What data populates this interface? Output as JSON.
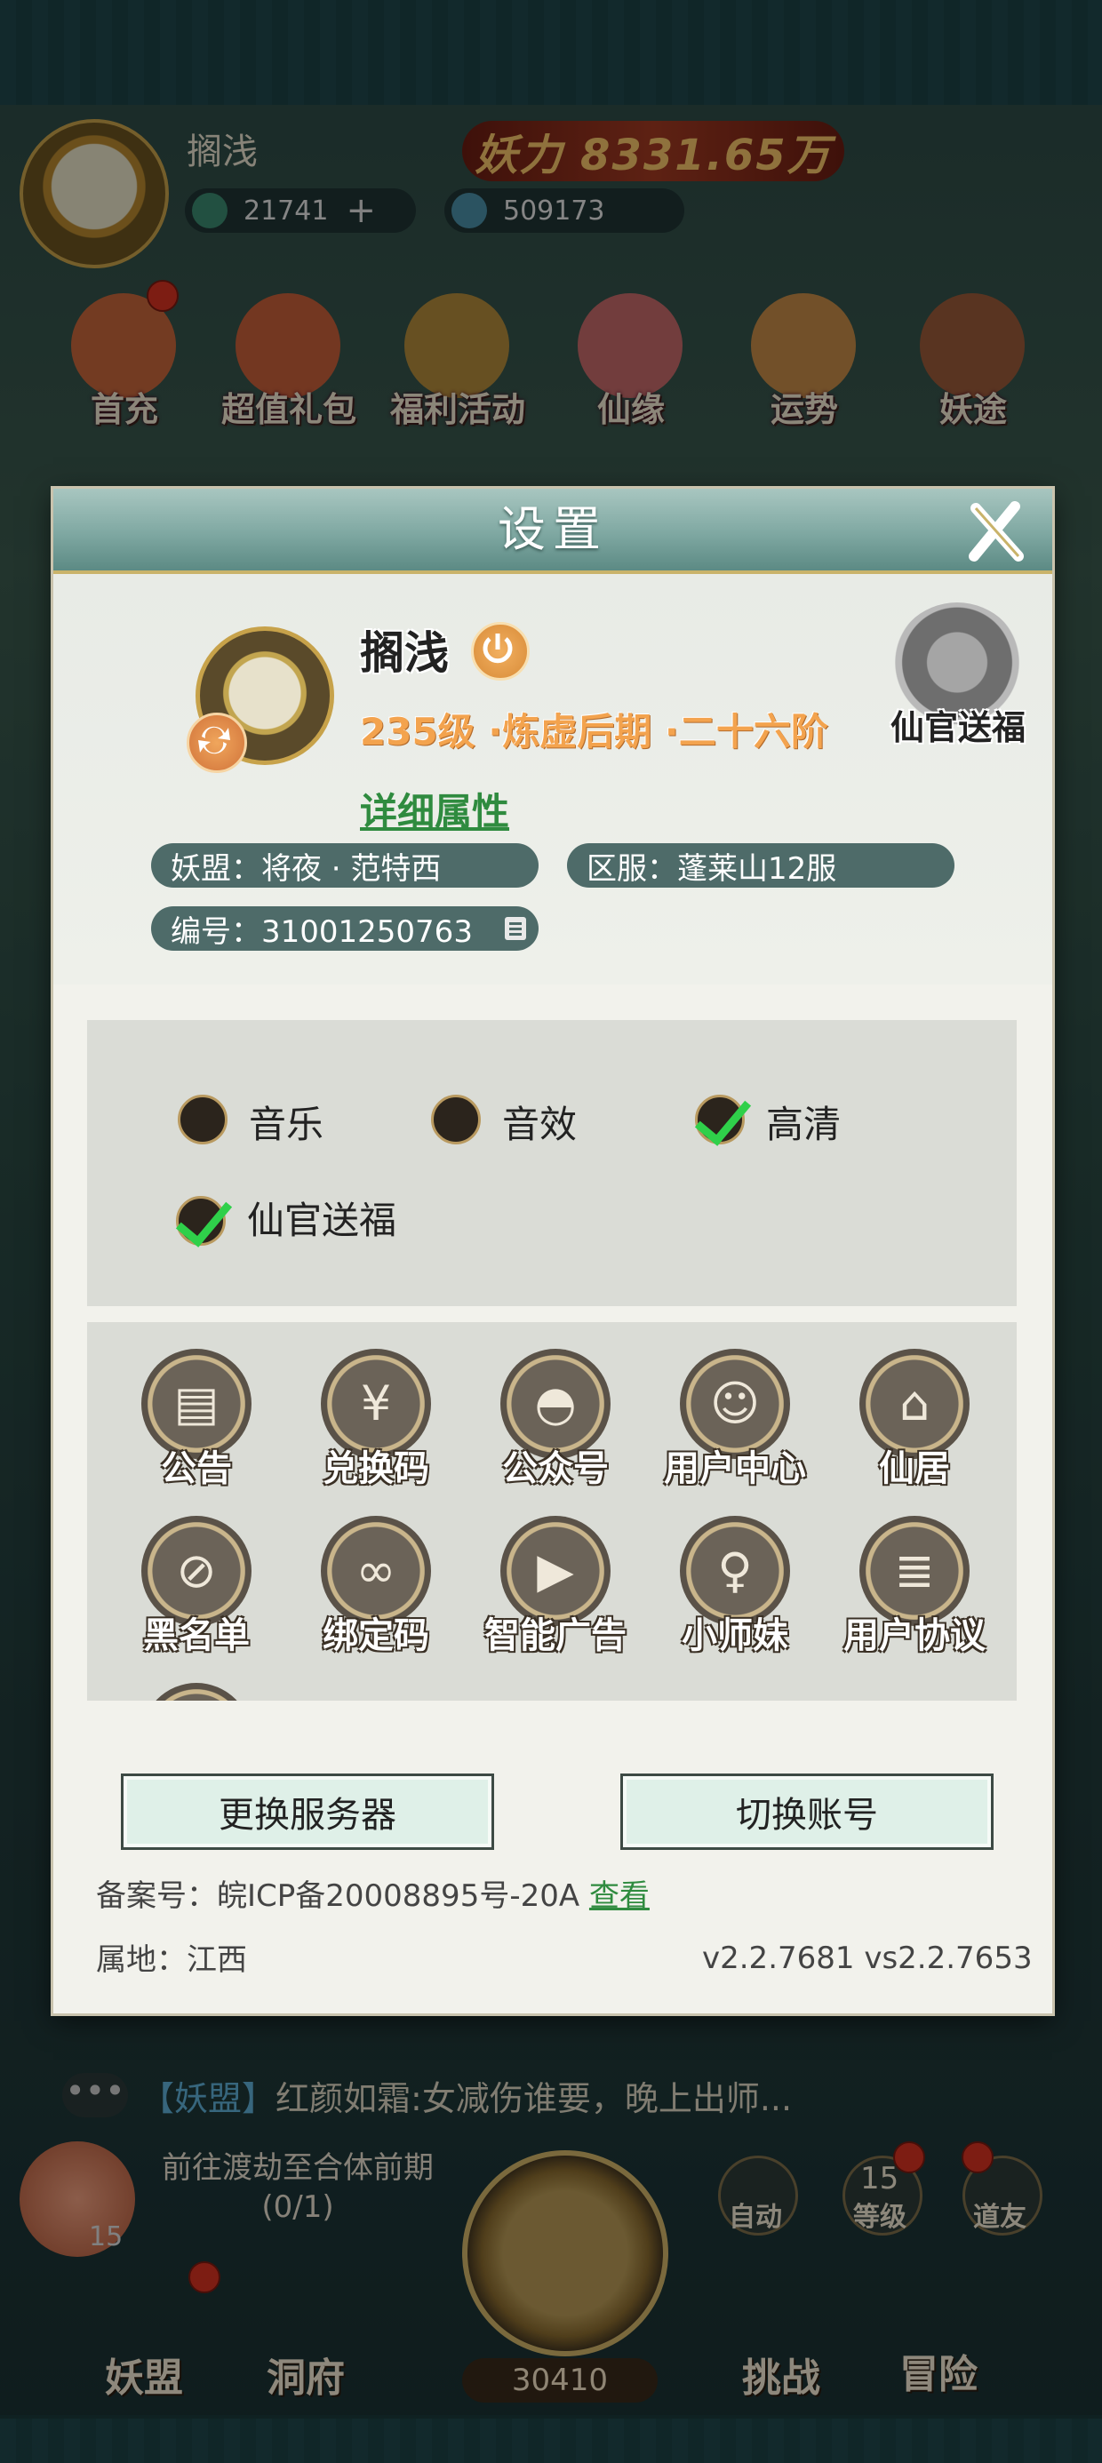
{
  "hud": {
    "player_name": "搁浅",
    "power_text": "妖力 8331.65万",
    "currency1": "21741",
    "currency2": "509173",
    "features": [
      "首充",
      "超值礼包",
      "福利活动",
      "仙缘",
      "运势",
      "妖途"
    ]
  },
  "chat": {
    "channel": "【妖盟】",
    "message": "红颜如霜:女减伤谁要，晚上出师..."
  },
  "quest": {
    "text": "前往渡劫至合体前期(0/1)"
  },
  "bottom": {
    "level_badge": "15",
    "counter": "30410",
    "side_buttons": [
      "自动",
      "等级",
      "道友"
    ],
    "side_level": "15",
    "tabs": [
      "妖盟",
      "洞府",
      "挑战",
      "冒险"
    ]
  },
  "dialog": {
    "title": "设置",
    "profile": {
      "name": "搁浅",
      "level": "235级 ·炼虚后期 ·二十六阶",
      "detail_link": "详细属性",
      "xianguan": "仙官送福",
      "alliance": "妖盟：将夜 · 范特西",
      "server": "区服：蓬莱山12服",
      "id_number": "编号：31001250763"
    },
    "options": [
      {
        "label": "音乐",
        "checked": false
      },
      {
        "label": "音效",
        "checked": false
      },
      {
        "label": "高清",
        "checked": true
      },
      {
        "label": "仙官送福",
        "checked": true
      }
    ],
    "functions": [
      {
        "label": "公告",
        "icon": "scroll-icon"
      },
      {
        "label": "兑换码",
        "icon": "money-bag-icon"
      },
      {
        "label": "公众号",
        "icon": "wechat-icon"
      },
      {
        "label": "用户中心",
        "icon": "user-fox-icon"
      },
      {
        "label": "仙居",
        "icon": "pavilion-icon"
      },
      {
        "label": "黑名单",
        "icon": "blocked-user-icon"
      },
      {
        "label": "绑定码",
        "icon": "link-icon"
      },
      {
        "label": "智能广告",
        "icon": "video-camera-icon"
      },
      {
        "label": "小师妹",
        "icon": "girl-avatar-icon"
      },
      {
        "label": "用户协议",
        "icon": "document-icon"
      }
    ],
    "buttons": {
      "change_server": "更换服务器",
      "switch_account": "切换账号"
    },
    "footer": {
      "icp": "备案号：皖ICP备20008895号-20A",
      "icp_link": "查看",
      "location": "属地：江西",
      "version": "v2.2.7681 vs2.2.7653"
    }
  },
  "colors": {
    "accent_green": "#2f8b3f",
    "level_orange": "#f3a34e",
    "check_green": "#2fd04a"
  }
}
